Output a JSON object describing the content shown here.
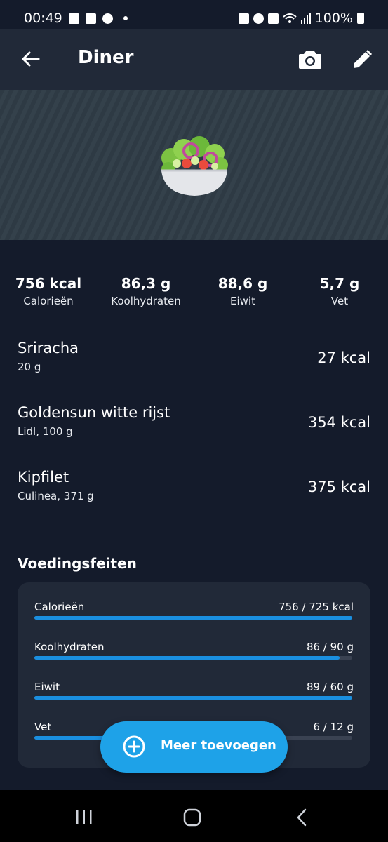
{
  "status_bar": {
    "time": "00:49",
    "battery": "100%"
  },
  "app_bar": {
    "title": "Diner"
  },
  "macros": [
    {
      "value": "756 kcal",
      "label": "Calorieën"
    },
    {
      "value": "86,3 g",
      "label": "Koolhydraten"
    },
    {
      "value": "88,6 g",
      "label": "Eiwit"
    },
    {
      "value": "5,7 g",
      "label": "Vet"
    }
  ],
  "foods": [
    {
      "name": "Sriracha",
      "detail": "20 g",
      "kcal": "27 kcal"
    },
    {
      "name": "Goldensun witte rijst",
      "detail": "Lidl, 100 g",
      "kcal": "354 kcal"
    },
    {
      "name": "Kipfilet",
      "detail": "Culinea, 371 g",
      "kcal": "375 kcal"
    }
  ],
  "nutrition": {
    "title": "Voedingsfeiten",
    "facts": [
      {
        "label": "Calorieën",
        "value": "756 / 725 kcal",
        "progress": 1.0
      },
      {
        "label": "Koolhydraten",
        "value": "86 / 90 g",
        "progress": 0.96
      },
      {
        "label": "Eiwit",
        "value": "89 / 60 g",
        "progress": 1.0
      },
      {
        "label": "Vet",
        "value": "6 / 12 g",
        "progress": 0.5
      }
    ]
  },
  "fab": {
    "label": "Meer toevoegen"
  },
  "colors": {
    "accent": "#1ea2e8",
    "background": "#141b2b",
    "card": "#212938",
    "bar": "#1a8fe0"
  }
}
